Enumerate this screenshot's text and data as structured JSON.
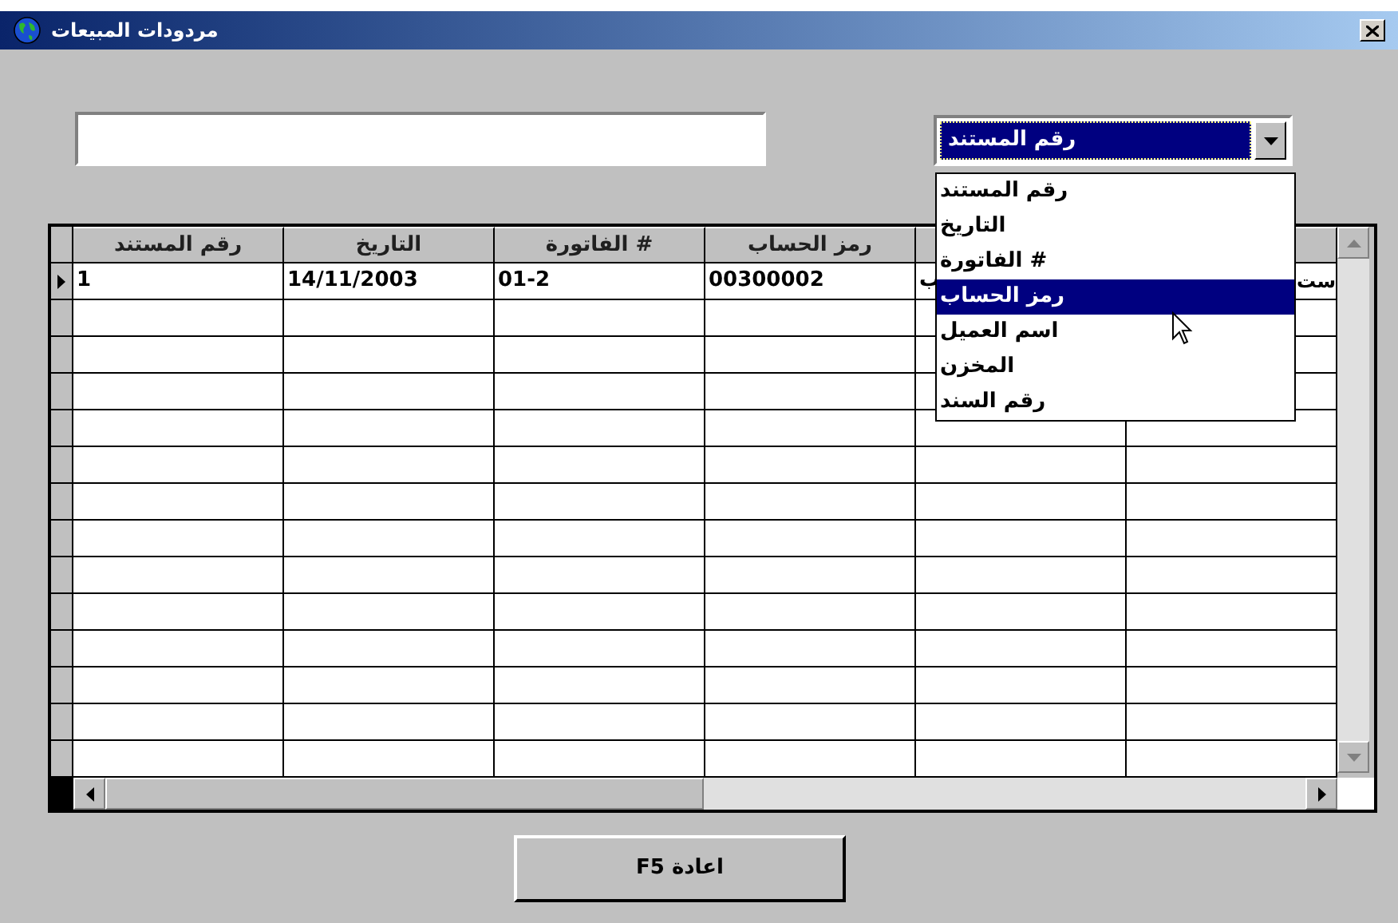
{
  "window": {
    "title": "مردودات المبيعات"
  },
  "field_combo": {
    "value": "رقم المستند",
    "focused": true
  },
  "dropdown": {
    "open": true,
    "items": [
      {
        "label": "رقم المستند",
        "selected": false
      },
      {
        "label": "التاريخ",
        "selected": false
      },
      {
        "label": "الفاتورة #",
        "selected": false
      },
      {
        "label": "رمز الحساب",
        "selected": true
      },
      {
        "label": "اسم العميل",
        "selected": false
      },
      {
        "label": "المخزن",
        "selected": false
      },
      {
        "label": "رقم السند",
        "selected": false
      }
    ]
  },
  "table": {
    "columns": [
      null,
      null,
      "رمز الحساب",
      "الفاتورة #",
      "التاريخ",
      "رقم المستند"
    ],
    "rows": [
      {
        "current": true,
        "cells": [
          "ست",
          "ب",
          "00300002",
          "01-2",
          "14/11/2003",
          "1"
        ]
      }
    ]
  },
  "buttons": [
    {
      "label": "F5 اعادة"
    }
  ]
}
